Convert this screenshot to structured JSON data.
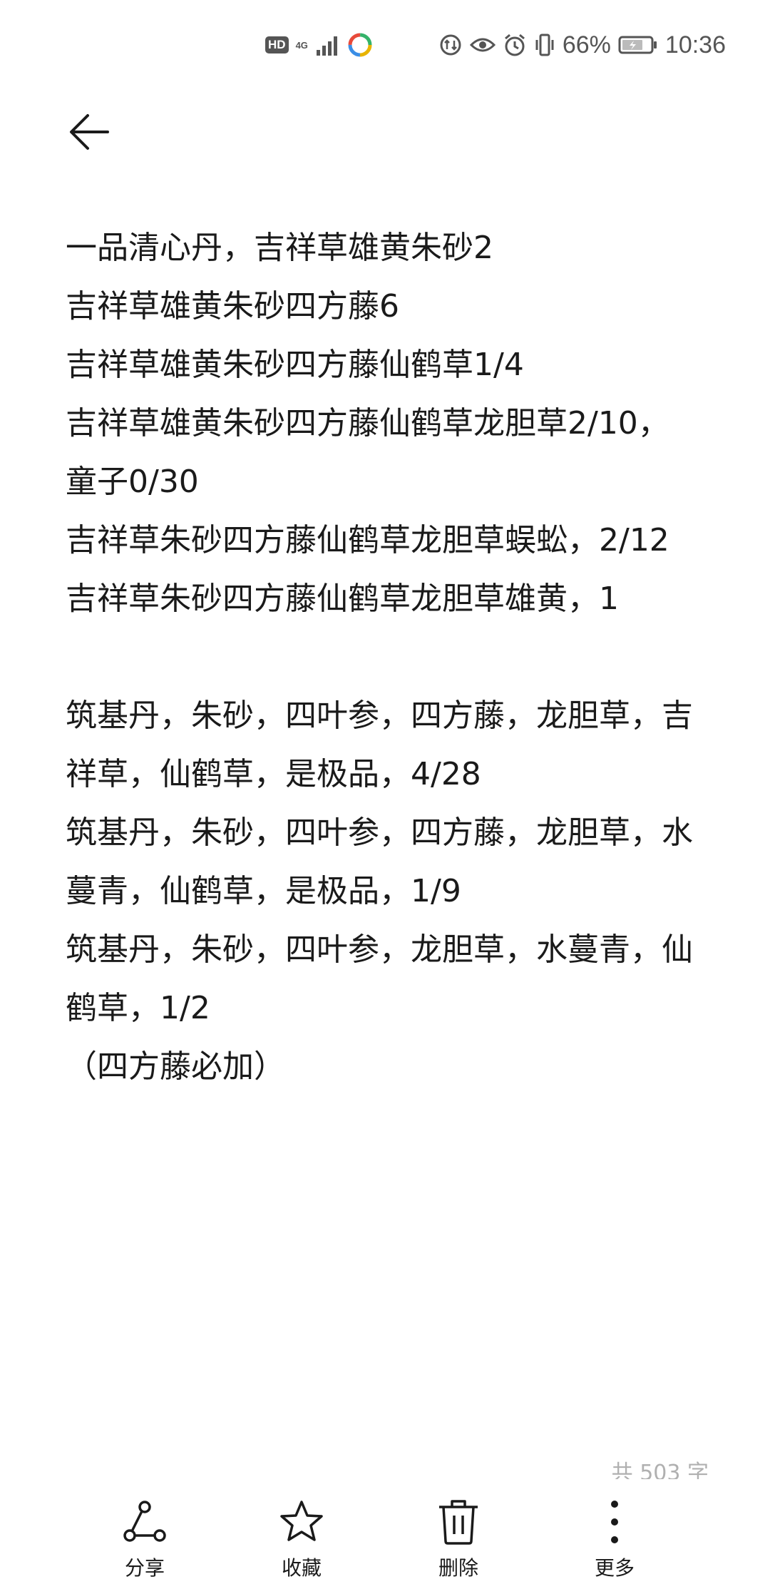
{
  "status_bar": {
    "hd": "HD",
    "network": "4G",
    "battery_percent": "66%",
    "time": "10:36"
  },
  "header": {
    "back_icon": "arrow-left-icon"
  },
  "note": {
    "lines": [
      "一品清心丹，吉祥草雄黄朱砂2",
      "吉祥草雄黄朱砂四方藤6",
      "吉祥草雄黄朱砂四方藤仙鹤草1/4",
      "吉祥草雄黄朱砂四方藤仙鹤草龙胆草2/10，",
      "童子0/30",
      "吉祥草朱砂四方藤仙鹤草龙胆草蜈蚣，2/12",
      "吉祥草朱砂四方藤仙鹤草龙胆草雄黄，1",
      "",
      "筑基丹，朱砂，四叶参，四方藤，龙胆草，吉",
      "祥草，仙鹤草，是极品，4/28",
      "筑基丹，朱砂，四叶参，四方藤，龙胆草，水",
      "蔓青，仙鹤草，是极品，1/9",
      "筑基丹，朱砂，四叶参，龙胆草，水蔓青，仙",
      "鹤草，1/2",
      "（四方藤必加）"
    ],
    "char_count": "共 503 字"
  },
  "bottom_bar": {
    "share_label": "分享",
    "favorite_label": "收藏",
    "delete_label": "删除",
    "more_label": "更多"
  },
  "colors": {
    "text": "#1a1a1a",
    "status_icon": "#555555",
    "muted": "#b0b0b0",
    "background": "#ffffff"
  }
}
